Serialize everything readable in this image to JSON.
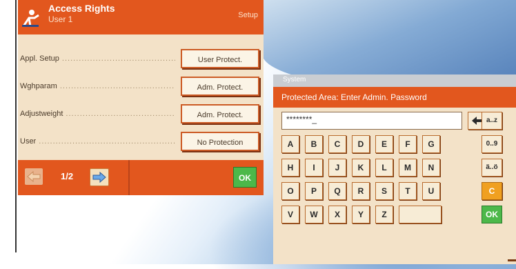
{
  "colors": {
    "accent": "#e2571e",
    "panel_bg": "#f3e2c8",
    "ok_green": "#4cb84a"
  },
  "access_panel": {
    "title": "Access Rights",
    "subtitle": "User 1",
    "corner_label": "Setup",
    "rows": [
      {
        "label": "Appl. Setup",
        "value": "User Protect."
      },
      {
        "label": "Wghparam",
        "value": "Adm. Protect."
      },
      {
        "label": "Adjustweight",
        "value": "Adm. Protect."
      },
      {
        "label": "User",
        "value": "No Protection"
      }
    ],
    "page_indicator": "1/2",
    "ok_label": "OK"
  },
  "keyboard_panel": {
    "title": "System",
    "prompt": "Protected Area: Enter Admin. Password",
    "password_value": "********_",
    "rows": [
      [
        "A",
        "B",
        "C",
        "D",
        "E",
        "F",
        "G"
      ],
      [
        "H",
        "I",
        "J",
        "K",
        "L",
        "M",
        "N"
      ],
      [
        "O",
        "P",
        "Q",
        "R",
        "S",
        "T",
        "U"
      ],
      [
        "V",
        "W",
        "X",
        "Y",
        "Z"
      ]
    ],
    "side_keys": [
      "a..z",
      "0..9",
      "ä..ö",
      "C",
      "OK"
    ],
    "backspace_icon": "left-arrow-icon"
  }
}
